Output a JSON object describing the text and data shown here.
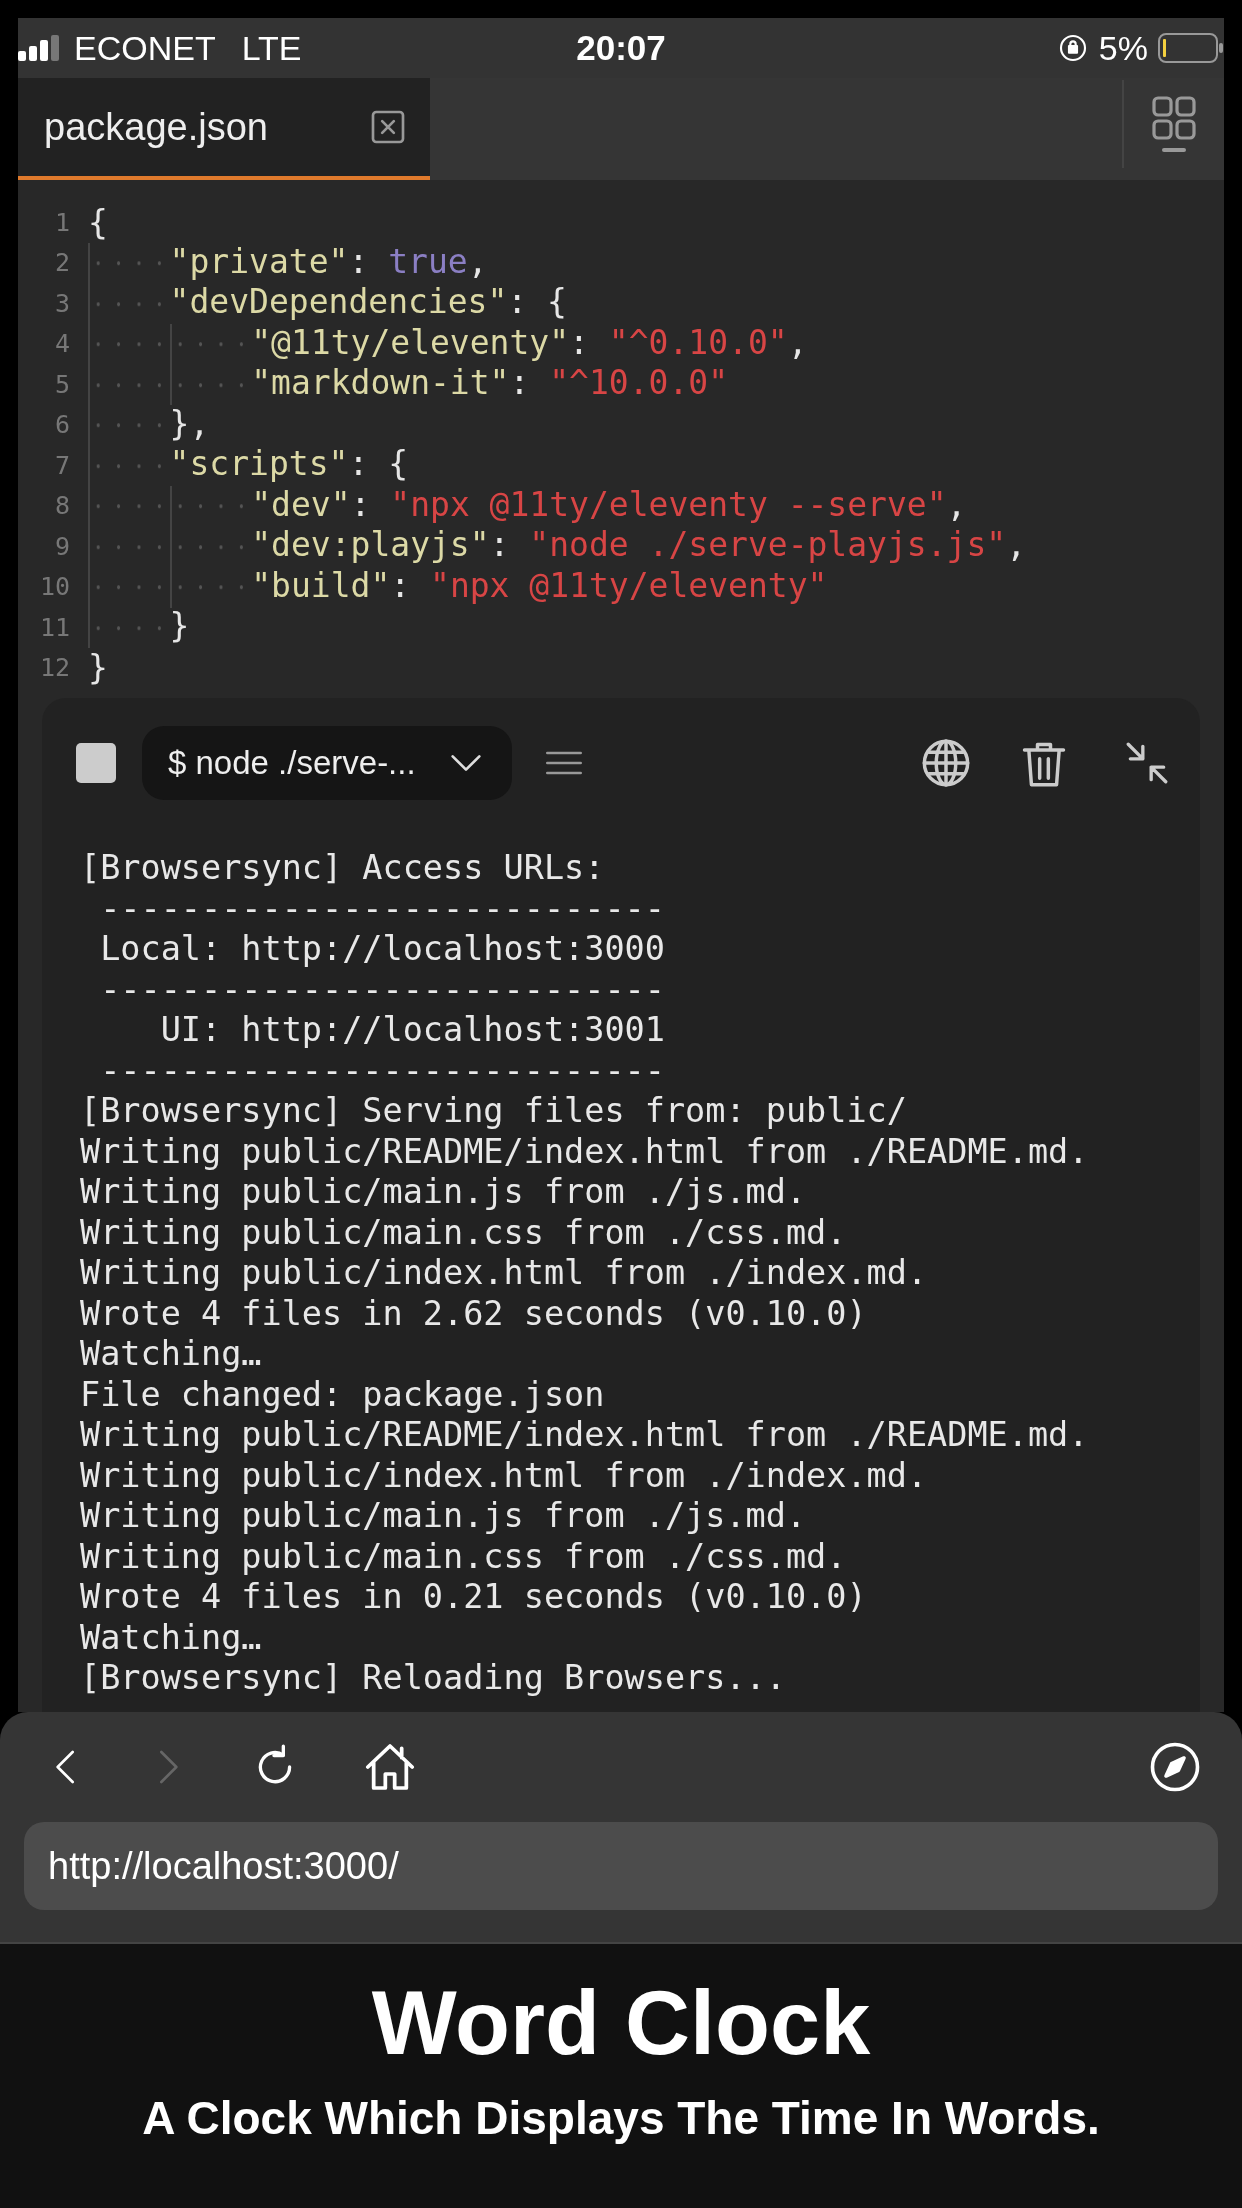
{
  "status_bar": {
    "carrier": "ECONET",
    "network": "LTE",
    "time": "20:07",
    "battery": "5%"
  },
  "tabs": [
    {
      "label": "package.json",
      "selected": true
    }
  ],
  "editor": {
    "lines": [
      {
        "number": "1",
        "tokens": [
          {
            "kind": "punct",
            "text": "{"
          }
        ]
      },
      {
        "number": "2",
        "tokens": [
          {
            "kind": "indent"
          },
          {
            "kind": "key",
            "text": "\"private\""
          },
          {
            "kind": "punct",
            "text": ": "
          },
          {
            "kind": "bool",
            "text": "true"
          },
          {
            "kind": "punct",
            "text": ","
          }
        ]
      },
      {
        "number": "3",
        "tokens": [
          {
            "kind": "indent"
          },
          {
            "kind": "key",
            "text": "\"devDependencies\""
          },
          {
            "kind": "punct",
            "text": ": {"
          }
        ]
      },
      {
        "number": "4",
        "tokens": [
          {
            "kind": "indent"
          },
          {
            "kind": "indent"
          },
          {
            "kind": "key",
            "text": "\"@11ty/eleventy\""
          },
          {
            "kind": "punct",
            "text": ": "
          },
          {
            "kind": "string",
            "text": "\"^0.10.0\""
          },
          {
            "kind": "punct",
            "text": ","
          }
        ]
      },
      {
        "number": "5",
        "tokens": [
          {
            "kind": "indent"
          },
          {
            "kind": "indent"
          },
          {
            "kind": "key",
            "text": "\"markdown-it\""
          },
          {
            "kind": "punct",
            "text": ": "
          },
          {
            "kind": "string",
            "text": "\"^10.0.0\""
          }
        ]
      },
      {
        "number": "6",
        "tokens": [
          {
            "kind": "indent"
          },
          {
            "kind": "punct",
            "text": "},"
          }
        ]
      },
      {
        "number": "7",
        "tokens": [
          {
            "kind": "indent"
          },
          {
            "kind": "key",
            "text": "\"scripts\""
          },
          {
            "kind": "punct",
            "text": ": {"
          }
        ]
      },
      {
        "number": "8",
        "tokens": [
          {
            "kind": "indent"
          },
          {
            "kind": "indent"
          },
          {
            "kind": "key",
            "text": "\"dev\""
          },
          {
            "kind": "punct",
            "text": ": "
          },
          {
            "kind": "string",
            "text": "\"npx @11ty/eleventy --serve\""
          },
          {
            "kind": "punct",
            "text": ","
          }
        ]
      },
      {
        "number": "9",
        "tokens": [
          {
            "kind": "indent"
          },
          {
            "kind": "indent"
          },
          {
            "kind": "key",
            "text": "\"dev:playjs\""
          },
          {
            "kind": "punct",
            "text": ": "
          },
          {
            "kind": "string",
            "text": "\"node ./serve-playjs.js\""
          },
          {
            "kind": "punct",
            "text": ","
          }
        ]
      },
      {
        "number": "10",
        "tokens": [
          {
            "kind": "indent"
          },
          {
            "kind": "indent"
          },
          {
            "kind": "key",
            "text": "\"build\""
          },
          {
            "kind": "punct",
            "text": ": "
          },
          {
            "kind": "string",
            "text": "\"npx @11ty/eleventy\""
          }
        ]
      },
      {
        "number": "11",
        "tokens": [
          {
            "kind": "indent"
          },
          {
            "kind": "punct",
            "text": "}"
          }
        ]
      },
      {
        "number": "12",
        "tokens": [
          {
            "kind": "punct",
            "text": "}"
          }
        ]
      }
    ]
  },
  "terminal": {
    "command": "$ node ./serve-...",
    "output": [
      "[Browsersync] Access URLs:",
      " ----------------------------",
      " Local: http://localhost:3000",
      " ----------------------------",
      "    UI: http://localhost:3001",
      " ----------------------------",
      "[Browsersync] Serving files from: public/",
      "Writing public/README/index.html from ./README.md.",
      "Writing public/main.js from ./js.md.",
      "Writing public/main.css from ./css.md.",
      "Writing public/index.html from ./index.md.",
      "Wrote 4 files in 2.62 seconds (v0.10.0)",
      "Watching…",
      "File changed: package.json",
      "Writing public/README/index.html from ./README.md.",
      "Writing public/index.html from ./index.md.",
      "Writing public/main.js from ./js.md.",
      "Writing public/main.css from ./css.md.",
      "Wrote 4 files in 0.21 seconds (v0.10.0)",
      "Watching…",
      "[Browsersync] Reloading Browsers..."
    ]
  },
  "browser": {
    "back_disabled": false,
    "forward_disabled": true,
    "url": "http://localhost:3000/"
  },
  "page": {
    "title": "Word Clock",
    "subtitle": "A Clock Which Displays The Time In Words."
  }
}
